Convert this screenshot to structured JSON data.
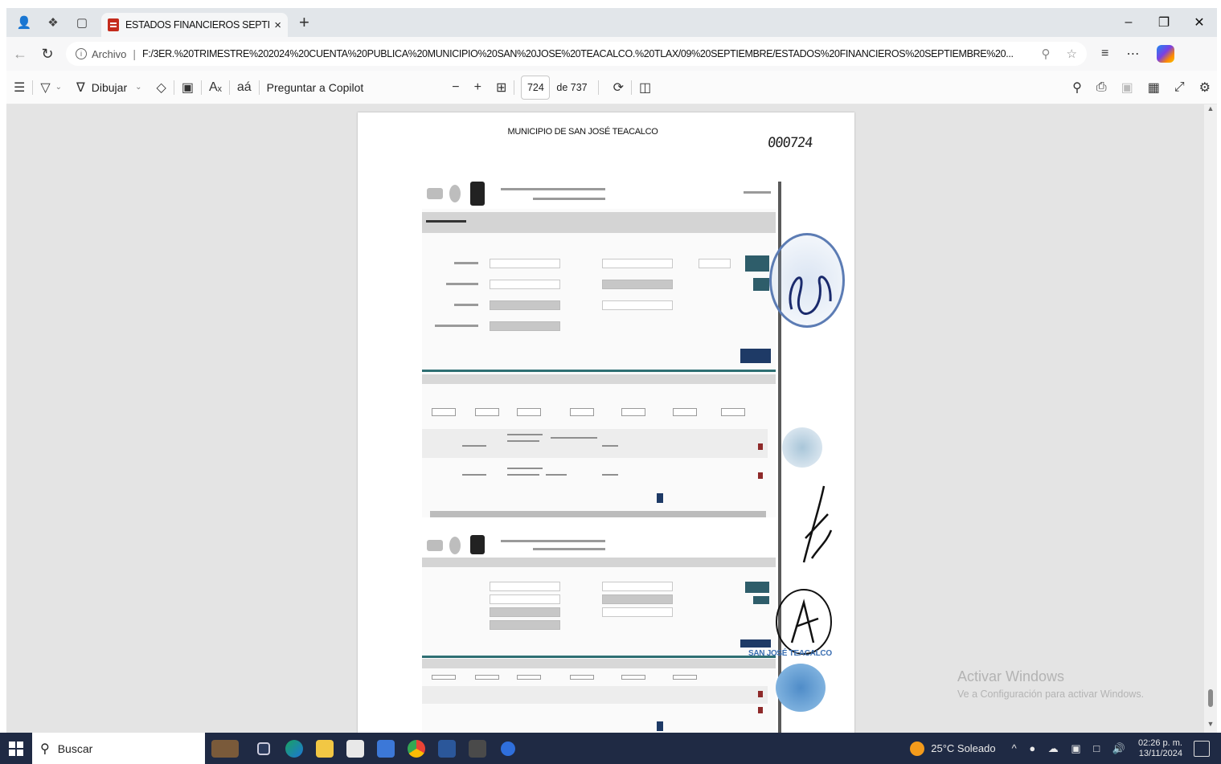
{
  "browser": {
    "tab_title": "ESTADOS FINANCIEROS SEPTIEM",
    "tab_close": "×",
    "new_tab": "+",
    "window_controls": {
      "minimize": "–",
      "restore": "❐",
      "close": "✕"
    }
  },
  "address_bar": {
    "scheme_label": "Archivo",
    "separator": "|",
    "url": "F:/3ER.%20TRIMESTRE%202024%20CUENTA%20PUBLICA%20MUNICIPIO%20SAN%20JOSE%20TEACALCO.%20TLAX/09%20SEPTIEMBRE/ESTADOS%20FINANCIEROS%20SEPTIEMBRE%20..."
  },
  "pdf_toolbar": {
    "draw_label": "Dibujar",
    "copilot_label": "Preguntar a Copilot",
    "zoom_out": "−",
    "zoom_in": "+",
    "current_page": "724",
    "page_count_text": "de 737"
  },
  "document": {
    "page_title": "MUNICIPIO DE SAN JOSÉ TEACALCO",
    "folio": "000724",
    "stamp_text": "SAN JOSÉ TEACALCO"
  },
  "windows_watermark": {
    "line1": "Activar Windows",
    "line2": "Ve a Configuración para activar Windows."
  },
  "taskbar": {
    "search_label": "Buscar",
    "weather": "25°C  Soleado",
    "time": "02:26 p. m.",
    "date": "13/11/2024"
  },
  "icons": [
    "profile-icon",
    "workspaces-icon",
    "tab-actions-icon",
    "pdf-icon",
    "back-icon",
    "refresh-icon",
    "info-icon",
    "zoom-page-icon",
    "favorite-star-icon",
    "favorites-icon",
    "more-icon",
    "copilot-icon",
    "contents-icon",
    "highlight-icon",
    "draw-icon",
    "erase-icon",
    "textbox-icon",
    "read-aloud-icon",
    "translate-icon",
    "fit-page-icon",
    "rotate-icon",
    "page-view-icon",
    "search-icon",
    "print-icon",
    "save-icon",
    "save-as-icon",
    "fullscreen-icon",
    "settings-icon",
    "windows-start-icon",
    "weather-icon",
    "notification-icon"
  ],
  "colors": {
    "tabstrip": "#e2e6ea",
    "viewer_bg": "#e4e4e4",
    "taskbar": "#1f2a44",
    "pdf_icon": "#c42b1c",
    "seal_blue": "#5c7cb4"
  }
}
